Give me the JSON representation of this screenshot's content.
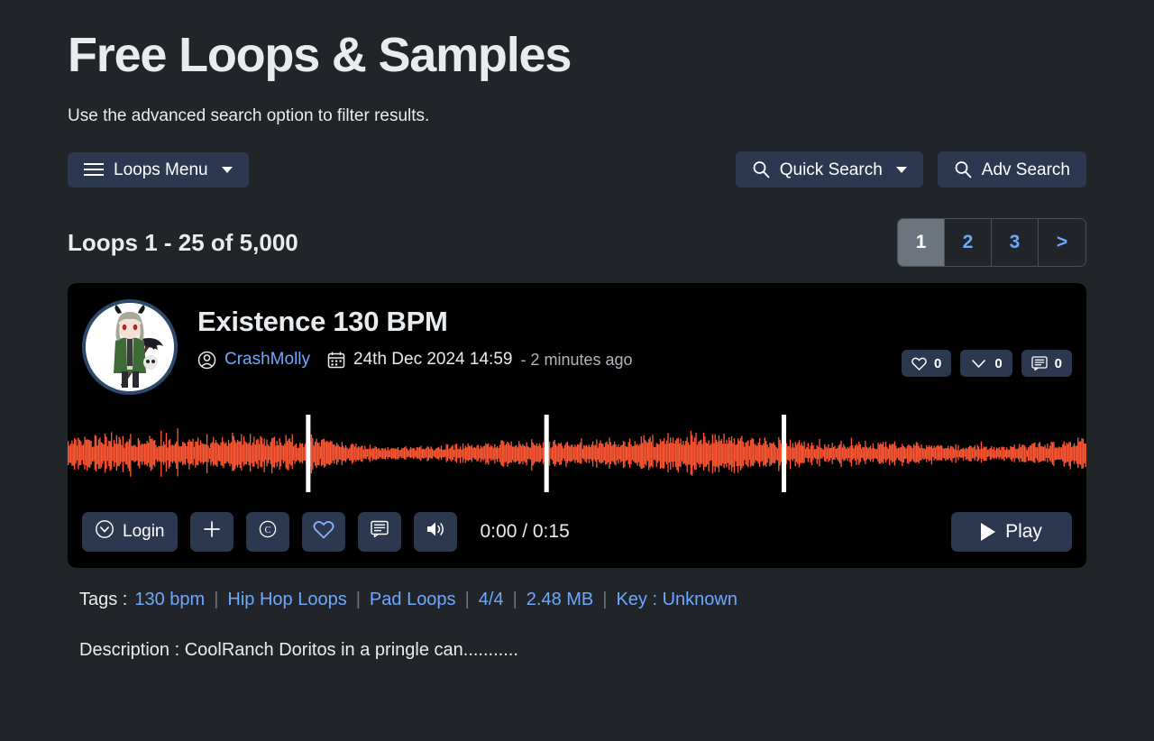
{
  "header": {
    "title": "Free Loops & Samples",
    "subtitle": "Use the advanced search option to filter results."
  },
  "toolbar": {
    "loops_menu_label": "Loops Menu",
    "quick_search_label": "Quick Search",
    "adv_search_label": "Adv Search"
  },
  "results": {
    "count_text": "Loops 1 - 25 of 5,000",
    "pagination": [
      {
        "label": "1",
        "active": true
      },
      {
        "label": "2",
        "active": false
      },
      {
        "label": "3",
        "active": false
      },
      {
        "label": ">",
        "active": false
      }
    ]
  },
  "track": {
    "title": "Existence 130 BPM",
    "user": "CrashMolly",
    "date": "24th Dec 2024 14:59",
    "ago": "- 2 minutes ago",
    "stats": [
      {
        "icon": "heart-icon",
        "value": "0"
      },
      {
        "icon": "download-icon",
        "value": "0"
      },
      {
        "icon": "comment-icon",
        "value": "0"
      }
    ],
    "player": {
      "login_label": "Login",
      "time_display": "0:00 / 0:15",
      "play_label": "Play",
      "current_time": "0:00",
      "duration": "0:15"
    },
    "tags_label": "Tags :",
    "tags": [
      "130 bpm",
      "Hip Hop Loops",
      "Pad Loops",
      "4/4",
      "2.48 MB",
      "Key : Unknown"
    ],
    "description": "Description : CoolRanch Doritos in a pringle can..........."
  },
  "colors": {
    "page_background": "#212529",
    "card_background": "#000000",
    "button_background": "#2b3850",
    "accent_link": "#6ea8fe",
    "waveform": "#ff5733",
    "marker": "#ffffff",
    "active_page": "#6c757d"
  }
}
